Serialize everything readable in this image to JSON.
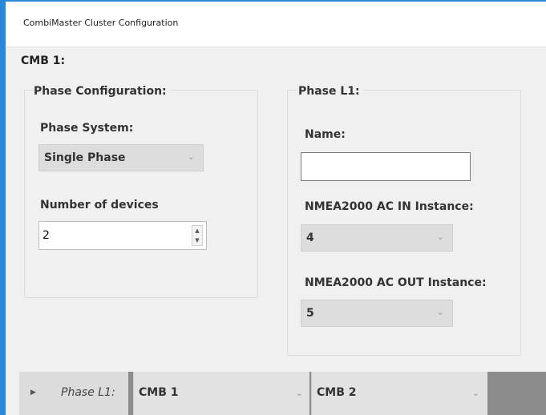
{
  "window": {
    "title": "CombiMaster Cluster Configuration",
    "accent_color": "#2b88d8"
  },
  "cluster": {
    "label": "CMB 1:"
  },
  "phase_config": {
    "group_title": "Phase Configuration:",
    "phase_system_label": "Phase System:",
    "phase_system_value": "Single Phase",
    "devices_label": "Number of devices",
    "devices_value": "2"
  },
  "phase_l1": {
    "group_title": "Phase L1:",
    "name_label": "Name:",
    "name_value": "",
    "ac_in_label": "NMEA2000 AC IN Instance:",
    "ac_in_value": "4",
    "ac_out_label": "NMEA2000 AC OUT Instance:",
    "ac_out_value": "5"
  },
  "grid_row": {
    "label": "Phase L1:",
    "cell1": "CMB 1",
    "cell2": "CMB 2"
  },
  "icons": {
    "dropdown": "chevron-down-icon",
    "spin_up": "spin-up-icon",
    "spin_down": "spin-down-icon",
    "row_expand": "row-expand-arrow-icon"
  }
}
